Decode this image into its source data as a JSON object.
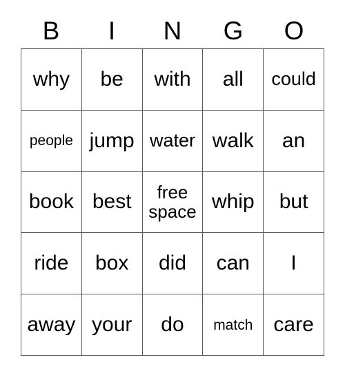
{
  "card": {
    "title_letters": [
      "B",
      "I",
      "N",
      "G",
      "O"
    ],
    "grid": {
      "columns": 5,
      "rows": 5,
      "border_color": "#595959",
      "background_color": "#ffffff",
      "text_color": "#000000",
      "cells": [
        {
          "text": "why",
          "size": "normal",
          "row": 1,
          "col": 1
        },
        {
          "text": "be",
          "size": "normal",
          "row": 1,
          "col": 2
        },
        {
          "text": "with",
          "size": "normal",
          "row": 1,
          "col": 3
        },
        {
          "text": "all",
          "size": "normal",
          "row": 1,
          "col": 4
        },
        {
          "text": "could",
          "size": "md",
          "row": 1,
          "col": 5
        },
        {
          "text": "people",
          "size": "sm",
          "row": 2,
          "col": 1
        },
        {
          "text": "jump",
          "size": "normal",
          "row": 2,
          "col": 2
        },
        {
          "text": "water",
          "size": "md",
          "row": 2,
          "col": 3
        },
        {
          "text": "walk",
          "size": "normal",
          "row": 2,
          "col": 4
        },
        {
          "text": "an",
          "size": "normal",
          "row": 2,
          "col": 5
        },
        {
          "text": "book",
          "size": "normal",
          "row": 3,
          "col": 1
        },
        {
          "text": "best",
          "size": "normal",
          "row": 3,
          "col": 2
        },
        {
          "text": "free space",
          "size": "wrap",
          "row": 3,
          "col": 3,
          "free_space": true
        },
        {
          "text": "whip",
          "size": "normal",
          "row": 3,
          "col": 4
        },
        {
          "text": "but",
          "size": "normal",
          "row": 3,
          "col": 5
        },
        {
          "text": "ride",
          "size": "normal",
          "row": 4,
          "col": 1
        },
        {
          "text": "box",
          "size": "normal",
          "row": 4,
          "col": 2
        },
        {
          "text": "did",
          "size": "normal",
          "row": 4,
          "col": 3
        },
        {
          "text": "can",
          "size": "normal",
          "row": 4,
          "col": 4
        },
        {
          "text": "I",
          "size": "normal",
          "row": 4,
          "col": 5
        },
        {
          "text": "away",
          "size": "normal",
          "row": 5,
          "col": 1
        },
        {
          "text": "your",
          "size": "normal",
          "row": 5,
          "col": 2
        },
        {
          "text": "do",
          "size": "normal",
          "row": 5,
          "col": 3
        },
        {
          "text": "match",
          "size": "sm",
          "row": 5,
          "col": 4
        },
        {
          "text": "care",
          "size": "normal",
          "row": 5,
          "col": 5
        }
      ]
    }
  }
}
